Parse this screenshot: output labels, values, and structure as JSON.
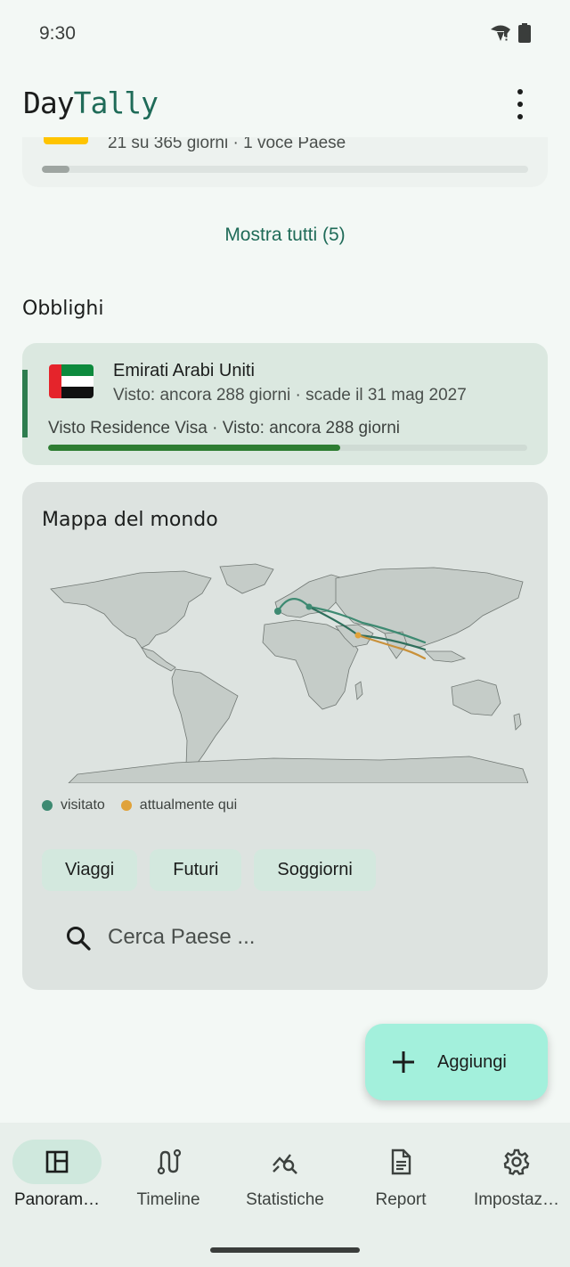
{
  "status": {
    "time": "9:30"
  },
  "app": {
    "title_day": "Day",
    "title_tally": "Tally"
  },
  "partial_card": {
    "subtitle": "21 su 365 giorni  ·  1 voce Paese",
    "progress_fraction": 0.057
  },
  "show_all": "Mostra tutti (5)",
  "obligations": {
    "title": "Obblighi",
    "items": [
      {
        "country": "Emirati Arabi Uniti",
        "subtitle": "Visto: ancora 288 giorni · scade il 31 mag 2027",
        "detail": "Visto Residence Visa · Visto: ancora 288 giorni",
        "progress_fraction": 0.61,
        "flag_icon": "uae-flag-icon"
      }
    ]
  },
  "map": {
    "title": "Mappa del mondo",
    "legend": [
      {
        "label": "visitato",
        "color": "#3e8a72"
      },
      {
        "label": "attualmente qui",
        "color": "#e0a23a"
      }
    ],
    "chips": [
      "Viaggi",
      "Futuri",
      "Soggiorni"
    ],
    "search_placeholder": "Cerca Paese ..."
  },
  "fab": {
    "label": "Aggiungi"
  },
  "nav": [
    {
      "label": "Panoram…",
      "icon": "dashboard-icon",
      "active": true
    },
    {
      "label": "Timeline",
      "icon": "route-icon",
      "active": false
    },
    {
      "label": "Statistiche",
      "icon": "query-stats-icon",
      "active": false
    },
    {
      "label": "Report",
      "icon": "document-icon",
      "active": false
    },
    {
      "label": "Impostaz…",
      "icon": "gear-icon",
      "active": false
    }
  ],
  "colors": {
    "accent": "#1f6b58",
    "fab": "#a3f0dc",
    "obligation_bar": "#2e7d32"
  }
}
